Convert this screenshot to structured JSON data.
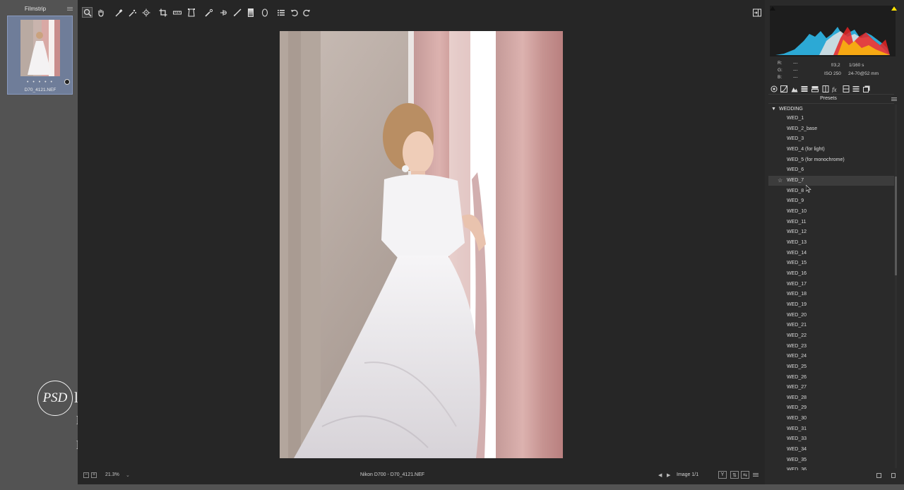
{
  "filmstrip": {
    "title": "Filmstrip",
    "stars": "• • • • •",
    "filename": "D70_4121.NEF"
  },
  "watermark": {
    "logo_text": "PSD",
    "frag1": "l",
    "frag2": "l",
    "frag3": "l"
  },
  "toolbar": {
    "tools": [
      "zoom-icon",
      "hand-icon",
      "white-balance-icon",
      "color-sampler-icon",
      "targeted-adjustment-icon",
      "crop-icon",
      "straighten-icon",
      "transform-icon",
      "spot-removal-icon",
      "red-eye-icon",
      "adjustment-brush-icon",
      "graduated-filter-icon",
      "radial-filter-icon",
      "preferences-icon",
      "rotate-left-icon",
      "rotate-right-icon"
    ]
  },
  "status": {
    "zoom": "21.3%",
    "zoom_dropdown": "⌄",
    "camera": "Nikon D700  -  D70_4121.NEF",
    "image_count": "Image 1/1",
    "prev": "◀",
    "next": "▶",
    "view_y": "Y",
    "view_swap": "⇅",
    "view_copy": "⇆",
    "zoom_out": "−",
    "zoom_in": "+"
  },
  "info": {
    "r_label": "R:",
    "g_label": "G:",
    "b_label": "B:",
    "r_value": "---",
    "g_value": "---",
    "b_value": "---",
    "aperture": "f/3,2",
    "shutter": "1/160 s",
    "iso": "ISO 250",
    "lens": "24-70@52 mm"
  },
  "presets": {
    "title": "Presets",
    "group": "WEDDING",
    "hovered": "WED_7",
    "items": [
      "WED_1",
      "WED_2_base",
      "WED_3",
      "WED_4 (for light)",
      "WED_5 (for monochrome)",
      "WED_6",
      "WED_7",
      "WED_8",
      "WED_9",
      "WED_10",
      "WED_11",
      "WED_12",
      "WED_13",
      "WED_14",
      "WED_15",
      "WED_16",
      "WED_17",
      "WED_18",
      "WED_19",
      "WED_20",
      "WED_21",
      "WED_22",
      "WED_23",
      "WED_24",
      "WED_25",
      "WED_26",
      "WED_27",
      "WED_28",
      "WED_29",
      "WED_30",
      "WED_31",
      "WED_33",
      "WED_34",
      "WED_35",
      "WED_36"
    ]
  },
  "colors": {
    "accent": "#6f7d99",
    "panel": "#2a2a2a",
    "canvas": "#262626",
    "highlight_clip": "#ffe200"
  }
}
